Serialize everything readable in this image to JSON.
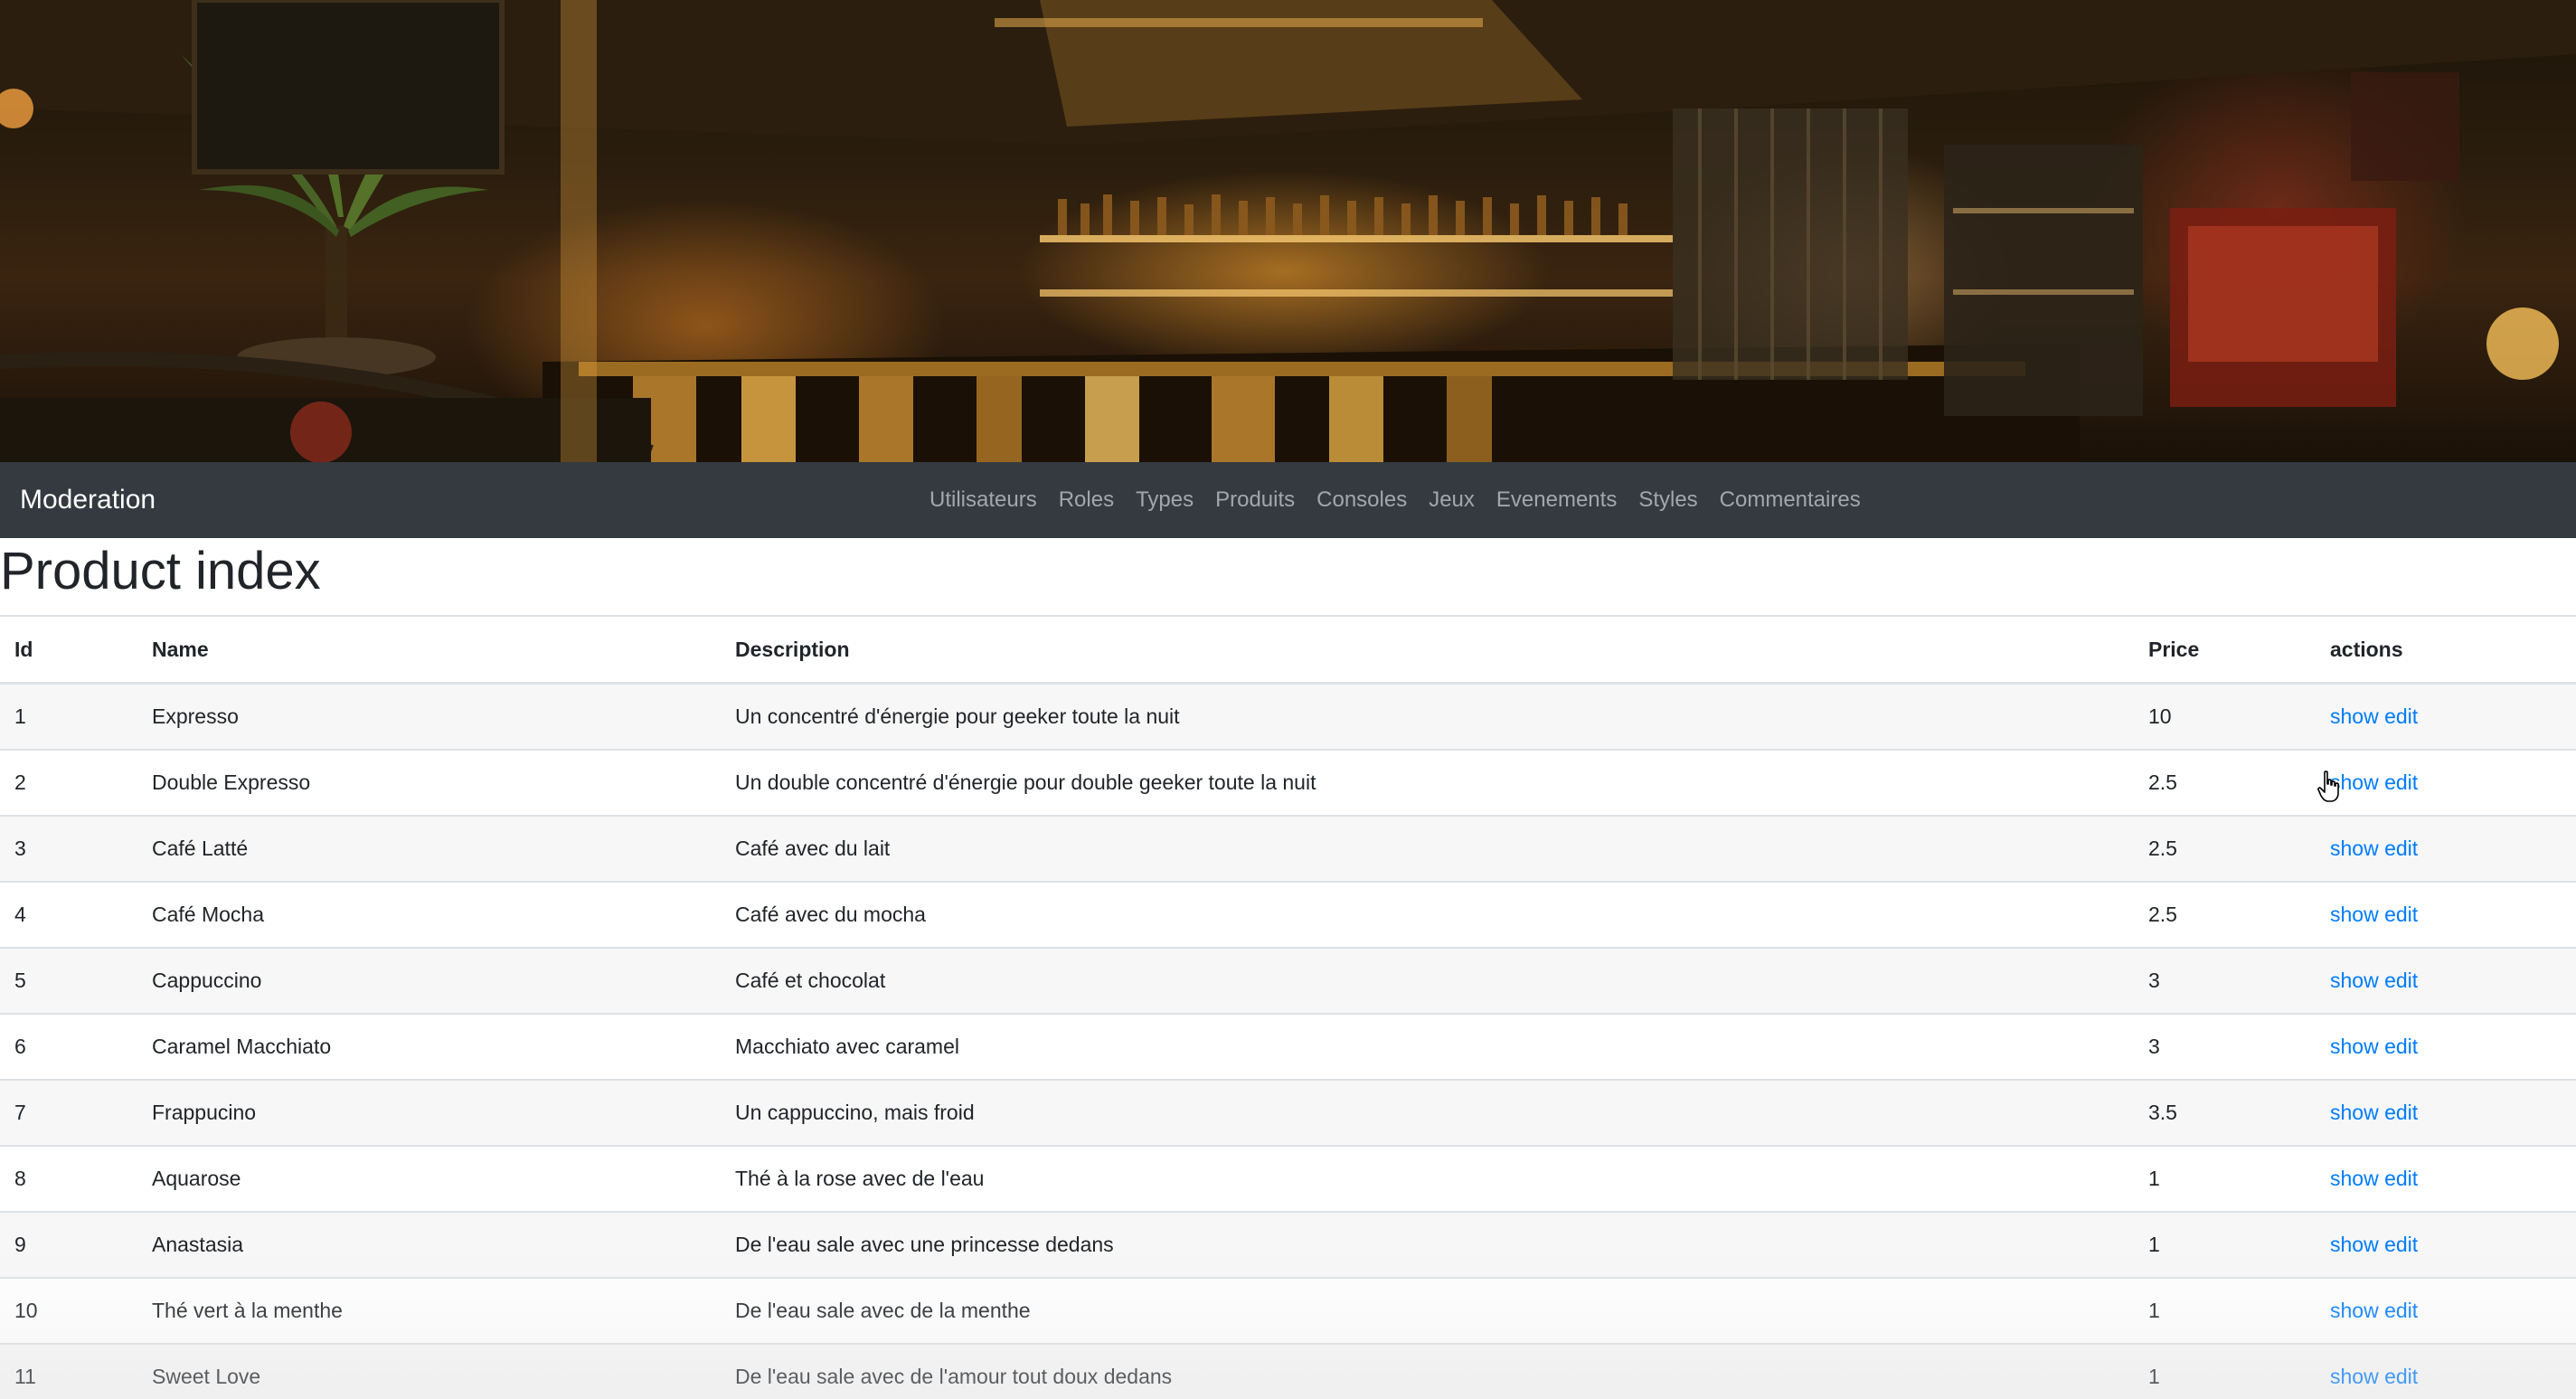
{
  "navbar": {
    "brand": "Moderation",
    "links": [
      "Utilisateurs",
      "Roles",
      "Types",
      "Produits",
      "Consoles",
      "Jeux",
      "Evenements",
      "Styles",
      "Commentaires"
    ]
  },
  "page": {
    "title": "Product index"
  },
  "table": {
    "headers": {
      "id": "Id",
      "name": "Name",
      "description": "Description",
      "price": "Price",
      "actions": "actions"
    },
    "rows": [
      {
        "id": "1",
        "name": "Expresso",
        "description": "Un concentré d'énergie pour geeker toute la nuit",
        "price": "10",
        "show": "show",
        "edit": "edit"
      },
      {
        "id": "2",
        "name": "Double Expresso",
        "description": "Un double concentré d'énergie pour double geeker toute la nuit",
        "price": "2.5",
        "show": "show",
        "edit": "edit"
      },
      {
        "id": "3",
        "name": "Café Latté",
        "description": "Café avec du lait",
        "price": "2.5",
        "show": "show",
        "edit": "edit"
      },
      {
        "id": "4",
        "name": "Café Mocha",
        "description": "Café avec du mocha",
        "price": "2.5",
        "show": "show",
        "edit": "edit"
      },
      {
        "id": "5",
        "name": "Cappuccino",
        "description": "Café et chocolat",
        "price": "3",
        "show": "show",
        "edit": "edit"
      },
      {
        "id": "6",
        "name": "Caramel Macchiato",
        "description": "Macchiato avec caramel",
        "price": "3",
        "show": "show",
        "edit": "edit"
      },
      {
        "id": "7",
        "name": "Frappucino",
        "description": "Un cappuccino, mais froid",
        "price": "3.5",
        "show": "show",
        "edit": "edit"
      },
      {
        "id": "8",
        "name": "Aquarose",
        "description": "Thé à la rose avec de l'eau",
        "price": "1",
        "show": "show",
        "edit": "edit"
      },
      {
        "id": "9",
        "name": "Anastasia",
        "description": "De l'eau sale avec une princesse dedans",
        "price": "1",
        "show": "show",
        "edit": "edit"
      },
      {
        "id": "10",
        "name": "Thé vert à la menthe",
        "description": "De l'eau sale avec de la menthe",
        "price": "1",
        "show": "show",
        "edit": "edit"
      },
      {
        "id": "11",
        "name": "Sweet Love",
        "description": "De l'eau sale avec de l'amour tout doux dedans",
        "price": "1",
        "show": "show",
        "edit": "edit"
      }
    ]
  },
  "colors": {
    "navbar_bg": "#343a40",
    "link": "#007bff",
    "row_shade": "#f7f7f7"
  },
  "icons": {
    "cursor": "hand-pointer-icon"
  }
}
